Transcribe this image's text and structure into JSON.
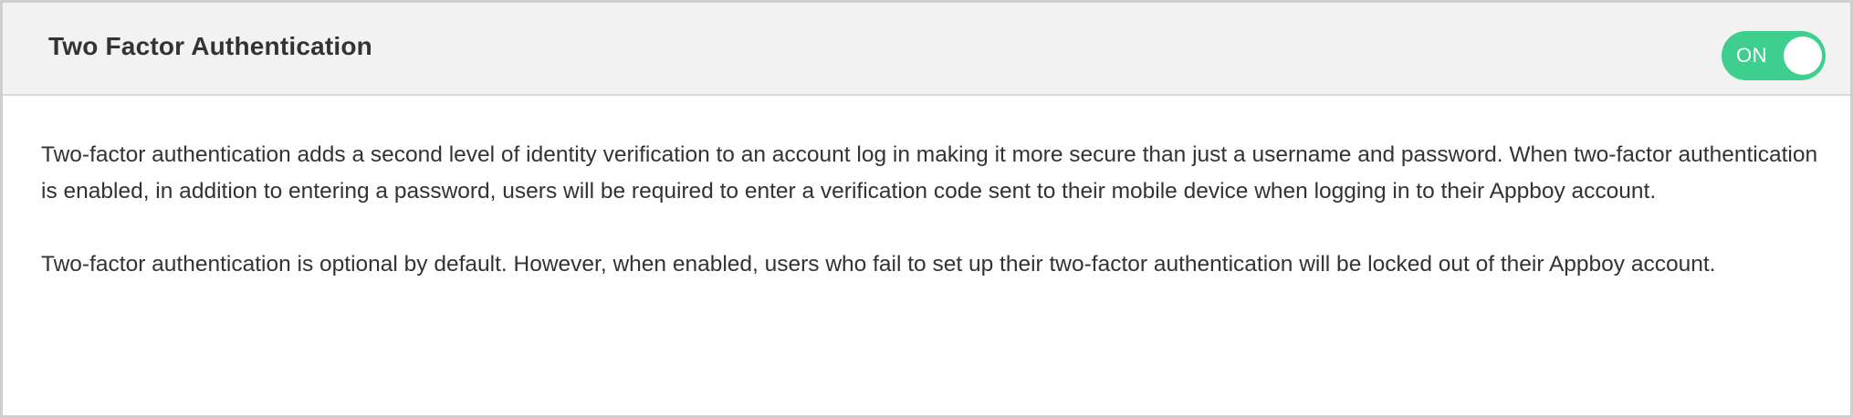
{
  "header": {
    "title": "Two Factor Authentication",
    "toggle": {
      "label": "ON",
      "state": "on",
      "color": "#3ecf8e"
    }
  },
  "body": {
    "paragraphs": [
      "Two-factor authentication adds a second level of identity verification to an account log in making it more secure than just a username and password. When two-factor authentication is enabled, in addition to entering a password, users will be required to enter a verification code sent to their mobile device when logging in to their Appboy account.",
      "Two-factor authentication is optional by default. However, when enabled, users who fail to set up their two-factor authentication will be locked out of their Appboy account."
    ]
  }
}
